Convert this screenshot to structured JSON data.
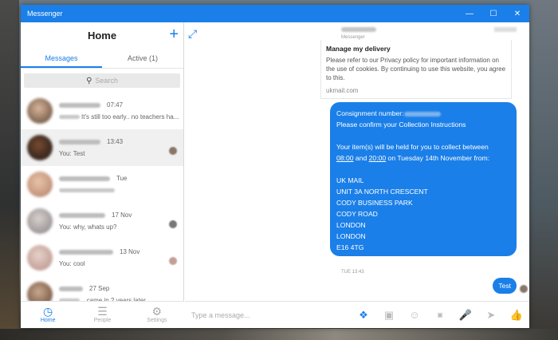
{
  "window": {
    "title": "Messenger",
    "minimize": "—",
    "maximize": "☐",
    "close": "✕"
  },
  "sidebar": {
    "title": "Home",
    "new_icon": "+",
    "tabs": [
      "Messages",
      "Active (1)"
    ],
    "search_placeholder": "Search",
    "conversations": [
      {
        "time": "07:47",
        "preview": "It's still too early.. no teachers ha..."
      },
      {
        "time": "13:43",
        "preview": "You: Test"
      },
      {
        "time": "Tue",
        "preview": ""
      },
      {
        "time": "17 Nov",
        "preview": "You: why, whats up?"
      },
      {
        "time": "13 Nov",
        "preview": "You: cool"
      },
      {
        "time": "27 Sep",
        "preview": "...came in 2 years later"
      }
    ],
    "nav": [
      "Home",
      "People",
      "Settings"
    ]
  },
  "chat": {
    "header_sub": "Messenger",
    "policy": {
      "title": "Manage my delivery",
      "body": "Please refer to our Privacy policy for important information on the use of cookies. By continuing to use this website, you agree to this.",
      "url": "ukmail.com"
    },
    "bubble": {
      "l1": "Consignment number:",
      "l2": "Please confirm your Collection Instructions",
      "l3": "Your item(s) will be held for you to collect between",
      "t1": "08:00",
      "and": " and ",
      "t2": "20:00",
      "l4rest": " on Tuesday 14th November from:",
      "addr": [
        "UK MAIL",
        "UNIT 3A NORTH CRESCENT",
        "CODY BUSINESS PARK",
        "CODY ROAD",
        "LONDON",
        "LONDON",
        "E16 4TG"
      ]
    },
    "timestamp": "TUE 13:43",
    "sent": "Test",
    "composer_placeholder": "Type a message..."
  },
  "colors": {
    "accent": "#1a7fe8"
  }
}
